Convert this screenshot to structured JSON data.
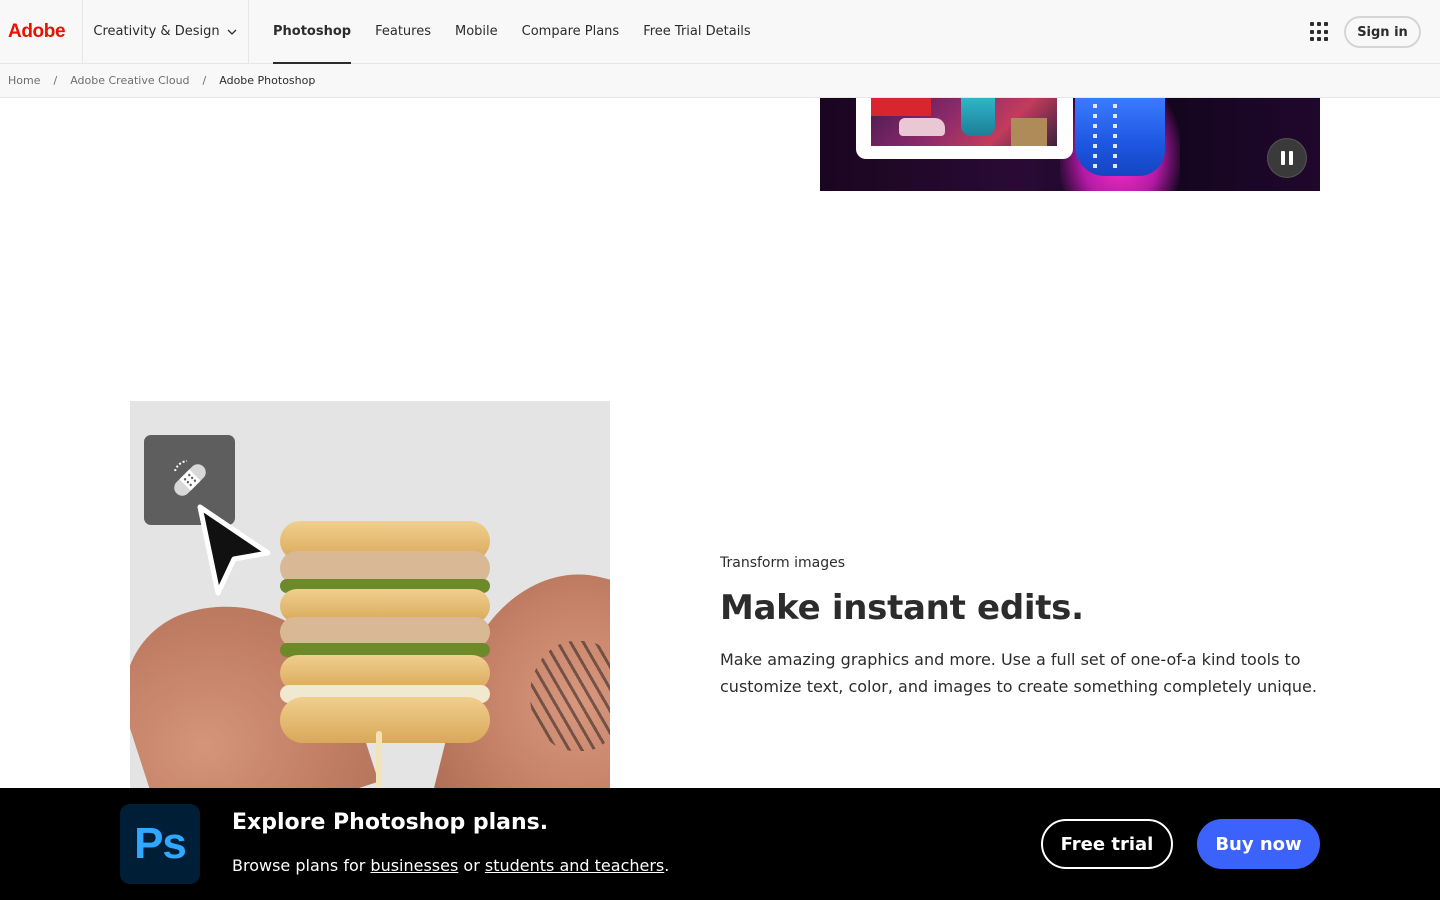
{
  "nav": {
    "brand": "Adobe",
    "category": "Creativity & Design",
    "links": [
      {
        "label": "Photoshop",
        "active": true
      },
      {
        "label": "Features"
      },
      {
        "label": "Mobile"
      },
      {
        "label": "Compare Plans"
      },
      {
        "label": "Free Trial Details"
      }
    ],
    "sign_in": "Sign in"
  },
  "breadcrumb": {
    "items": [
      "Home",
      "Adobe Creative Cloud",
      "Adobe Photoshop"
    ],
    "separator": "/"
  },
  "feature": {
    "eyebrow": "Transform images",
    "headline": "Make instant edits.",
    "body": "Make amazing graphics and more. Use a full set of one-of-a kind tools to customize text, color, and images to create something completely unique."
  },
  "sticky": {
    "logo": "Ps",
    "title": "Explore Photoshop plans.",
    "sub_prefix": "Browse plans for ",
    "link_business": "businesses",
    "sub_mid": " or ",
    "link_students": "students and teachers",
    "sub_suffix": ".",
    "free_trial": "Free trial",
    "buy_now": "Buy now"
  },
  "colors": {
    "adobe_red": "#eb1000",
    "buy_blue": "#3b63fb",
    "ps_navy": "#001e36",
    "ps_blue": "#31a8ff"
  },
  "icons": [
    "chevron-down-icon",
    "apps-grid-icon",
    "pause-icon",
    "bandage-healing-icon",
    "cursor-arrow-icon"
  ]
}
